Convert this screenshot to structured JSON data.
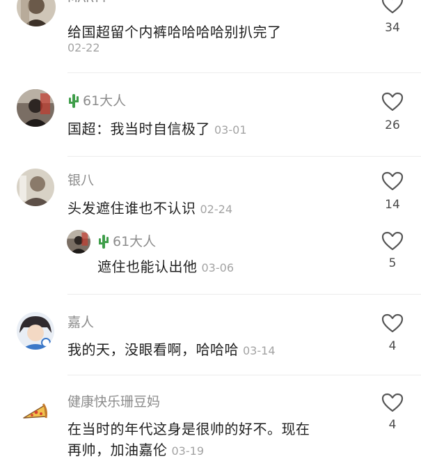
{
  "comments": [
    {
      "username": "MARYT",
      "text": "给国超留个内裤哈哈哈哈别扒完了",
      "date": "02-22",
      "likes": "34",
      "avatar_icon": "user-avatar-photo"
    },
    {
      "username": "61大人",
      "text": "国超：我当时自信极了",
      "date": "03-01",
      "likes": "26",
      "avatar_icon": "user-avatar-photo",
      "badge_icon": "cactus-icon"
    },
    {
      "username": "银八",
      "text": "头发遮住谁也不认识",
      "date": "02-24",
      "likes": "14",
      "avatar_icon": "user-avatar-photo",
      "replies": [
        {
          "username": "61大人",
          "text": "遮住也能认出他",
          "date": "03-06",
          "likes": "5",
          "avatar_icon": "user-avatar-photo",
          "badge_icon": "cactus-icon"
        }
      ]
    },
    {
      "username": "嘉人",
      "text": "我的天，没眼看啊，哈哈哈",
      "date": "03-14",
      "likes": "4",
      "avatar_icon": "user-avatar-photo"
    },
    {
      "username": "健康快乐珊豆妈",
      "text": "在当时的年代这身是很帅的好不。现在",
      "text_line2": "再帅，加油嘉伦",
      "date": "03-19",
      "likes": "4",
      "avatar_icon": "pizza-icon"
    }
  ],
  "colors": {
    "username": "#8c8c8c",
    "text": "#1f1f1f",
    "date": "#a3a3a3",
    "heart": "#555555",
    "cactus": "#3f9e4a"
  }
}
